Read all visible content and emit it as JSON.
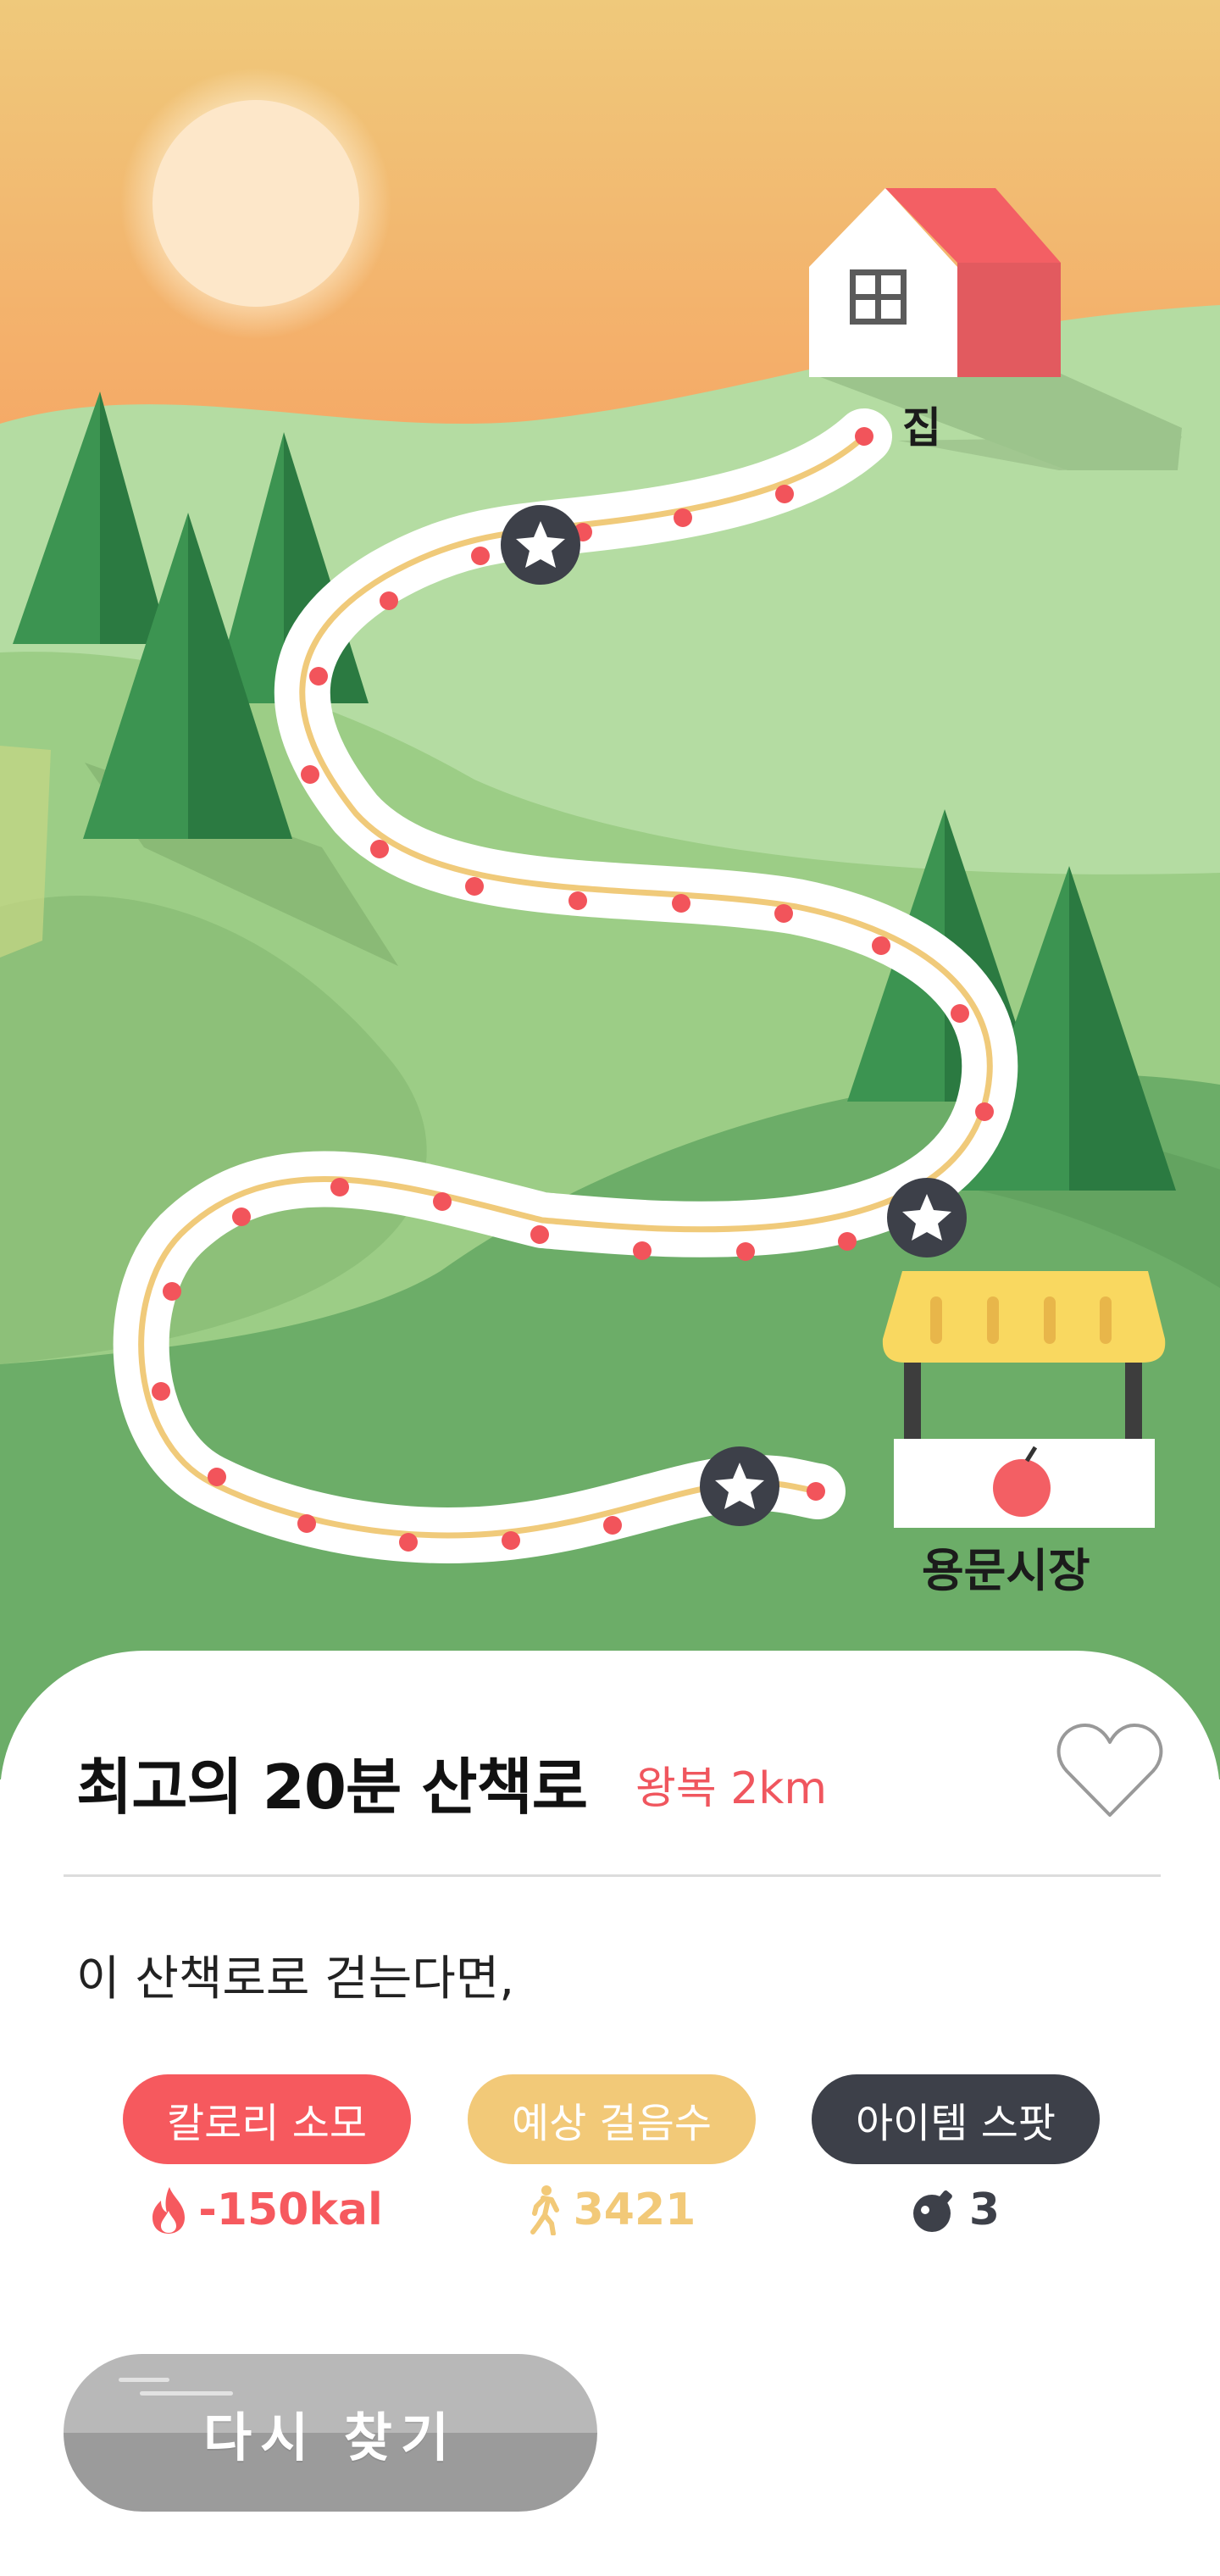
{
  "map": {
    "home_label": "집",
    "market_label": "용문시장"
  },
  "route": {
    "title": "최고의 20분 산책로",
    "distance": "왕복 2km",
    "favorite_icon": "heart-icon",
    "subtitle": "이 산책로로 걷는다면,"
  },
  "stats": {
    "calories": {
      "label": "칼로리 소모",
      "value": "-150kal",
      "icon": "flame-icon",
      "color": "#f6595e"
    },
    "steps": {
      "label": "예상 걸음수",
      "value": "3421",
      "icon": "walking-person-icon",
      "color": "#f2c978"
    },
    "items": {
      "label": "아이템 스팟",
      "value": "3",
      "icon": "bomb-icon",
      "color": "#3d4049"
    }
  },
  "actions": {
    "retry_label": "다시 찾기"
  },
  "colors": {
    "accent_red": "#f6595e",
    "accent_yellow": "#f2c978",
    "dark": "#3d4049",
    "path_dot": "#f2545b"
  }
}
